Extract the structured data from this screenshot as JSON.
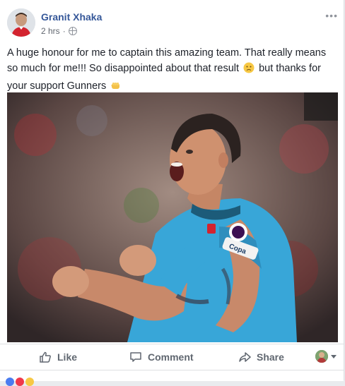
{
  "post": {
    "author": "Granit Xhaka",
    "time": "2 hrs",
    "text_part1": "A huge honour for me to captain this amazing team. That really means so much for me!!! So disappointed about that result ",
    "text_part2": " but thanks for your support Gunners ",
    "emoji1": "disappointed-face-emoji",
    "emoji2": "fist-emoji",
    "photo_badges": [
      "Copa"
    ]
  },
  "actions": {
    "like": "Like",
    "comment": "Comment",
    "share": "Share"
  },
  "colors": {
    "author_link": "#365899",
    "action_text": "#606770",
    "jersey": "#38a6d8"
  }
}
